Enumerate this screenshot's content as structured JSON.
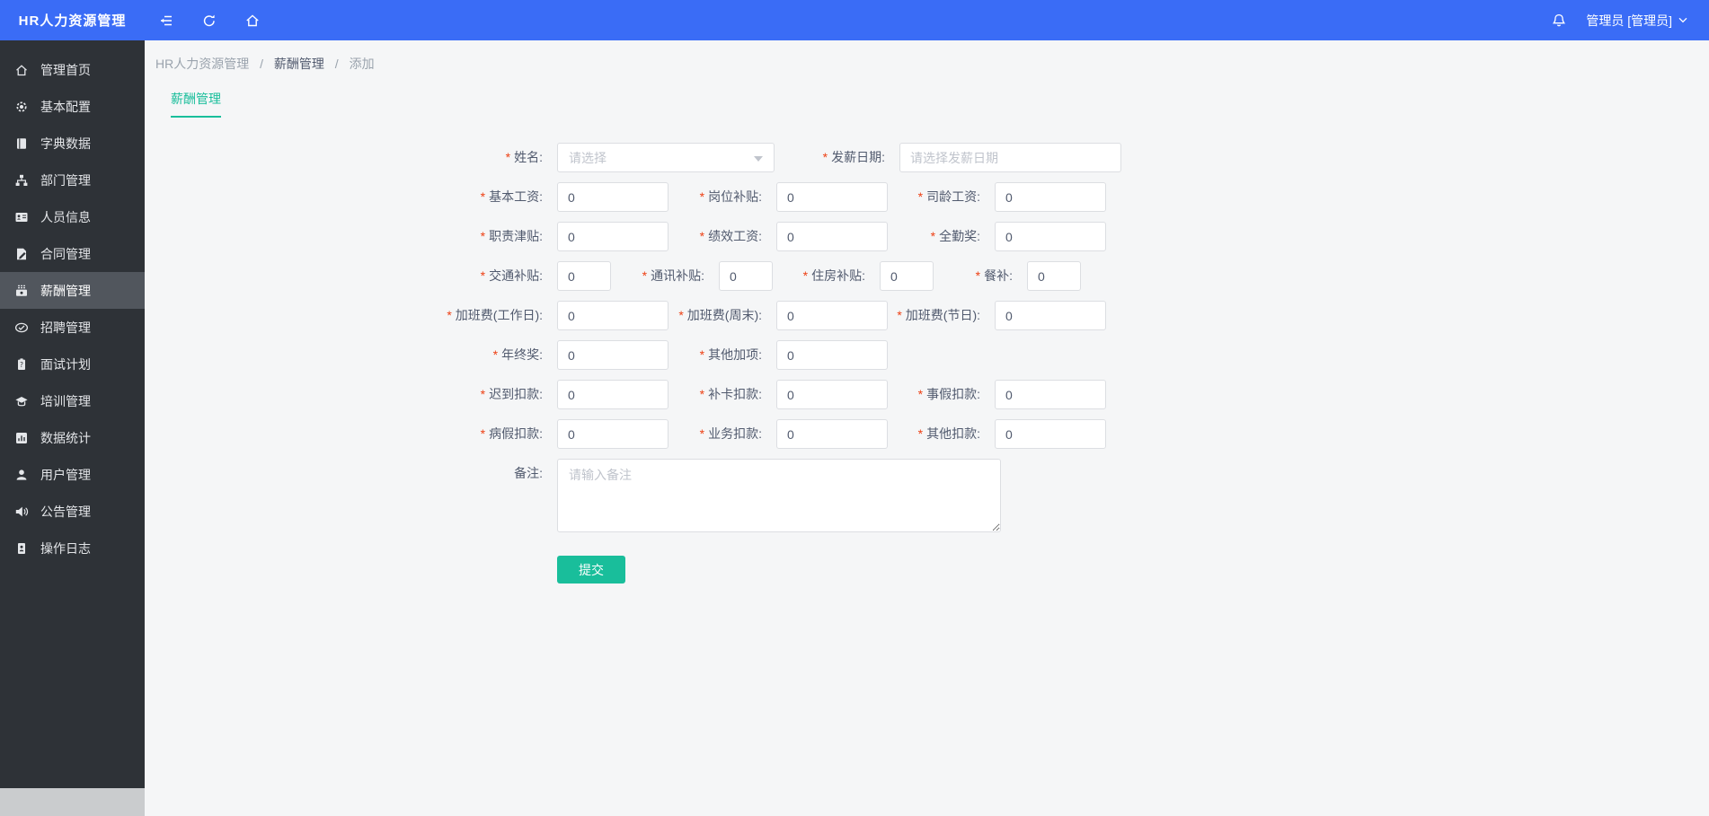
{
  "app": {
    "title": "HR人力资源管理"
  },
  "header": {
    "icons": [
      "collapse-menu",
      "refresh",
      "home",
      "bell",
      "chevron-down"
    ],
    "user_label": "管理员 [管理员]"
  },
  "sidebar": {
    "items": [
      {
        "label": "管理首页",
        "icon": "home-icon",
        "active": false
      },
      {
        "label": "基本配置",
        "icon": "gear-icon",
        "active": false
      },
      {
        "label": "字典数据",
        "icon": "book-icon",
        "active": false
      },
      {
        "label": "部门管理",
        "icon": "sitemap-icon",
        "active": false
      },
      {
        "label": "人员信息",
        "icon": "id-card-icon",
        "active": false
      },
      {
        "label": "合同管理",
        "icon": "contract-icon",
        "active": false
      },
      {
        "label": "薪酬管理",
        "icon": "salary-icon",
        "active": true
      },
      {
        "label": "招聘管理",
        "icon": "recruit-icon",
        "active": false
      },
      {
        "label": "面试计划",
        "icon": "interview-icon",
        "active": false
      },
      {
        "label": "培训管理",
        "icon": "training-icon",
        "active": false
      },
      {
        "label": "数据统计",
        "icon": "stats-icon",
        "active": false
      },
      {
        "label": "用户管理",
        "icon": "user-icon",
        "active": false
      },
      {
        "label": "公告管理",
        "icon": "announce-icon",
        "active": false
      },
      {
        "label": "操作日志",
        "icon": "log-icon",
        "active": false
      }
    ]
  },
  "breadcrumb": {
    "items": [
      "HR人力资源管理",
      "薪酬管理",
      "添加"
    ],
    "separator": "/"
  },
  "tab": {
    "label": "薪酬管理"
  },
  "form": {
    "required_marker": "*",
    "rows": [
      {
        "fields": [
          {
            "label": "姓名:",
            "required": true,
            "type": "select",
            "placeholder": "请选择"
          },
          {
            "label": "发薪日期:",
            "required": true,
            "type": "date",
            "placeholder": "请选择发薪日期"
          }
        ]
      },
      {
        "fields": [
          {
            "label": "基本工资:",
            "required": true,
            "type": "number",
            "value": "0"
          },
          {
            "label": "岗位补贴:",
            "required": true,
            "type": "number",
            "value": "0"
          },
          {
            "label": "司龄工资:",
            "required": true,
            "type": "number",
            "value": "0"
          }
        ]
      },
      {
        "fields": [
          {
            "label": "职责津贴:",
            "required": true,
            "type": "number",
            "value": "0"
          },
          {
            "label": "绩效工资:",
            "required": true,
            "type": "number",
            "value": "0"
          },
          {
            "label": "全勤奖:",
            "required": true,
            "type": "number",
            "value": "0"
          }
        ]
      },
      {
        "fields": [
          {
            "label": "交通补贴:",
            "required": true,
            "type": "number",
            "value": "0"
          },
          {
            "label": "通讯补贴:",
            "required": true,
            "type": "number",
            "value": "0"
          },
          {
            "label": "住房补贴:",
            "required": true,
            "type": "number",
            "value": "0"
          },
          {
            "label": "餐补:",
            "required": true,
            "type": "number",
            "value": "0"
          }
        ]
      },
      {
        "fields": [
          {
            "label": "加班费(工作日):",
            "required": true,
            "type": "number",
            "value": "0"
          },
          {
            "label": "加班费(周末):",
            "required": true,
            "type": "number",
            "value": "0"
          },
          {
            "label": "加班费(节日):",
            "required": true,
            "type": "number",
            "value": "0"
          }
        ]
      },
      {
        "fields": [
          {
            "label": "年终奖:",
            "required": true,
            "type": "number",
            "value": "0"
          },
          {
            "label": "其他加项:",
            "required": true,
            "type": "number",
            "value": "0"
          }
        ]
      },
      {
        "fields": [
          {
            "label": "迟到扣款:",
            "required": true,
            "type": "number",
            "value": "0"
          },
          {
            "label": "补卡扣款:",
            "required": true,
            "type": "number",
            "value": "0"
          },
          {
            "label": "事假扣款:",
            "required": true,
            "type": "number",
            "value": "0"
          }
        ]
      },
      {
        "fields": [
          {
            "label": "病假扣款:",
            "required": true,
            "type": "number",
            "value": "0"
          },
          {
            "label": "业务扣款:",
            "required": true,
            "type": "number",
            "value": "0"
          },
          {
            "label": "其他扣款:",
            "required": true,
            "type": "number",
            "value": "0"
          }
        ]
      },
      {
        "fields": [
          {
            "label": "备注:",
            "required": false,
            "type": "textarea",
            "placeholder": "请输入备注"
          }
        ]
      }
    ],
    "submit_label": "提交"
  },
  "colors": {
    "header_bg": "#3a6cf6",
    "sidebar_bg": "#2e3237",
    "sidebar_active_bg": "#51565d",
    "accent_teal": "#19be9b",
    "required_red": "#ed4014",
    "content_bg": "#f5f6f7",
    "input_border": "#dcdee2",
    "placeholder_gray": "#c0c4cc"
  }
}
